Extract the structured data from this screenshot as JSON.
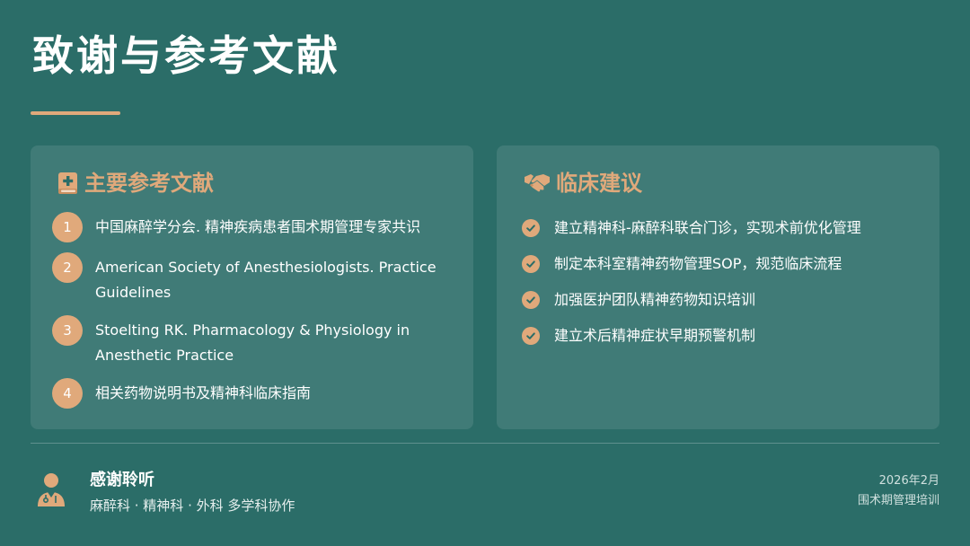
{
  "title": "致谢与参考文献",
  "references": {
    "heading": "主要参考文献",
    "icon": "book-plus-icon",
    "items": [
      {
        "num": "1",
        "text": "中国麻醉学分会. 精神疾病患者围术期管理专家共识"
      },
      {
        "num": "2",
        "text": "American Society of Anesthesiologists. Practice Guidelines"
      },
      {
        "num": "3",
        "text": "Stoelting RK. Pharmacology & Physiology in Anesthetic Practice"
      },
      {
        "num": "4",
        "text": "相关药物说明书及精神科临床指南"
      }
    ]
  },
  "recommendations": {
    "heading": "临床建议",
    "icon": "handshake-icon",
    "items": [
      "建立精神科-麻醉科联合门诊，实现术前优化管理",
      "制定本科室精神药物管理SOP，规范临床流程",
      "加强医护团队精神药物知识培训",
      "建立术后精神症状早期预警机制"
    ]
  },
  "footer": {
    "title": "感谢聆听",
    "subtitle": "麻醉科 · 精神科 · 外科 多学科协作",
    "date": "2026年2月",
    "event": "围术期管理培训"
  },
  "colors": {
    "background": "#2b6d68",
    "accent": "#e0a97b",
    "panel": "rgba(255,255,255,0.10)"
  }
}
